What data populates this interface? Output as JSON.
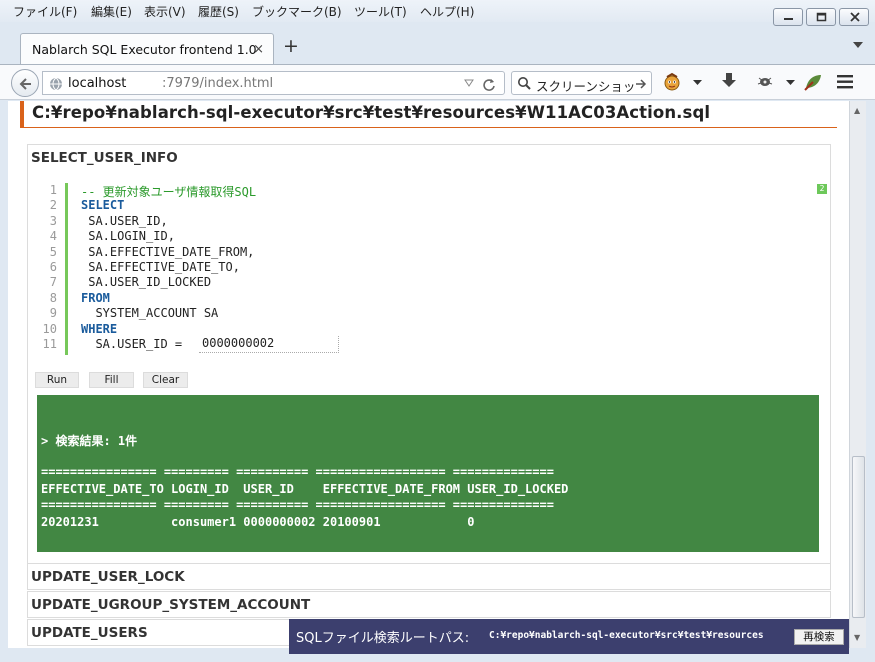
{
  "menu": {
    "file": "ファイル(F)",
    "edit": "編集(E)",
    "view": "表示(V)",
    "history": "履歴(S)",
    "bookmarks": "ブックマーク(B)",
    "tools": "ツール(T)",
    "help": "ヘルプ(H)"
  },
  "tab": {
    "title": "Nablarch SQL Executor frontend 1.0",
    "close": "×"
  },
  "new_tab": "+",
  "url": {
    "host": "localhost",
    "path": ":7979/index.html"
  },
  "search": {
    "placeholder": "スクリーンショッ"
  },
  "file": {
    "title": "C:¥repo¥nablarch-sql-executor¥src¥test¥resources¥W11AC03Action.sql"
  },
  "statement": {
    "name": "SELECT_USER_INFO",
    "lines": [
      {
        "n": "1",
        "text": "-- 更新対象ユーザ情報取得SQL",
        "cls": "cm"
      },
      {
        "n": "2",
        "text": "SELECT",
        "cls": "kw"
      },
      {
        "n": "3",
        "text": " SA.USER_ID,",
        "cls": ""
      },
      {
        "n": "4",
        "text": " SA.LOGIN_ID,",
        "cls": ""
      },
      {
        "n": "5",
        "text": " SA.EFFECTIVE_DATE_FROM,",
        "cls": ""
      },
      {
        "n": "6",
        "text": " SA.EFFECTIVE_DATE_TO,",
        "cls": ""
      },
      {
        "n": "7",
        "text": " SA.USER_ID_LOCKED",
        "cls": ""
      },
      {
        "n": "8",
        "text": "FROM",
        "cls": "kw"
      },
      {
        "n": "9",
        "text": "  SYSTEM_ACCOUNT SA",
        "cls": ""
      },
      {
        "n": "10",
        "text": "WHERE",
        "cls": "kw"
      },
      {
        "n": "11",
        "text": "  SA.USER_ID = ",
        "cls": ""
      }
    ],
    "param_value": "0000000002",
    "badge": "2",
    "buttons": {
      "run": "Run",
      "fill": "Fill",
      "clear": "Clear"
    },
    "result": {
      "summary": "> 検索結果: 1件",
      "separator": "================ ========= ========== ================== ==============",
      "header": "EFFECTIVE_DATE_TO LOGIN_ID  USER_ID    EFFECTIVE_DATE_FROM USER_ID_LOCKED",
      "row": "20201231          consumer1 0000000002 20100901            0"
    }
  },
  "other_statements": [
    "UPDATE_USER_LOCK",
    "UPDATE_UGROUP_SYSTEM_ACCOUNT",
    "UPDATE_USERS"
  ],
  "footer": {
    "label": "SQLファイル検索ルートパス:",
    "path": "C:¥repo¥nablarch-sql-executor¥src¥test¥resources",
    "button": "再検索"
  },
  "colors": {
    "accent": "#d9621a",
    "result_bg": "#428743",
    "footer_bg": "#3c3f6e",
    "keyword": "#1a5b9c",
    "comment": "#2b9a2b"
  }
}
